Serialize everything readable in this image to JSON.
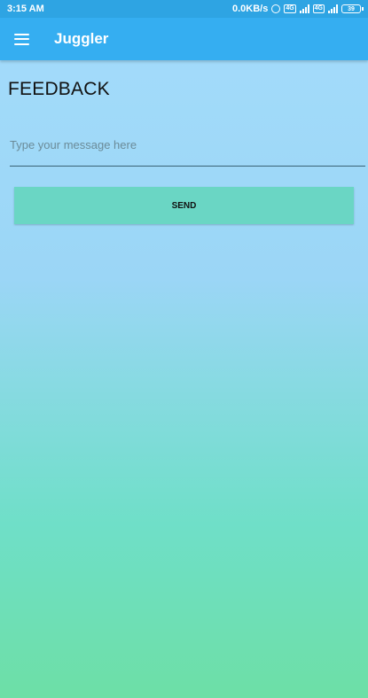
{
  "status_bar": {
    "time": "3:15 AM",
    "network_speed": "0.0KB/s",
    "sim1_label": "4G",
    "sim2_label": "4G",
    "battery_level": "39",
    "icons": [
      "alarm-icon",
      "signal-icon",
      "signal-icon",
      "battery-icon"
    ]
  },
  "app_bar": {
    "title": "Juggler",
    "menu_icon": "hamburger-menu-icon"
  },
  "feedback": {
    "heading": "FEEDBACK",
    "message_placeholder": "Type your message here",
    "message_value": "",
    "send_label": "SEND"
  },
  "colors": {
    "status_bar": "#2ea4e3",
    "app_bar": "#35aef1",
    "send_button": "#6ad6c4",
    "background_top": "#a4dcfb",
    "background_bottom": "#6ddfa6"
  }
}
